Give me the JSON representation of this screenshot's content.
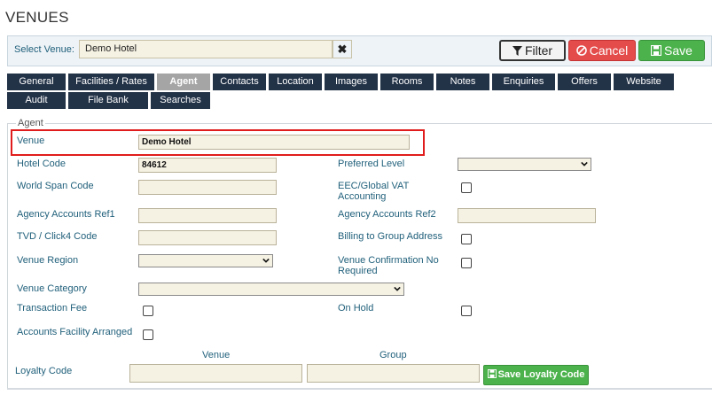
{
  "page": {
    "title": "VENUES"
  },
  "select_venue": {
    "label": "Select Venue:",
    "value": "Demo Hotel",
    "clear_glyph": "✖"
  },
  "actions": {
    "filter": "Filter",
    "cancel": "Cancel",
    "save": "Save"
  },
  "tabs": [
    {
      "label": "General",
      "active": false
    },
    {
      "label": "Facilities / Rates",
      "active": false
    },
    {
      "label": "Agent",
      "active": true
    },
    {
      "label": "Contacts",
      "active": false
    },
    {
      "label": "Location",
      "active": false
    },
    {
      "label": "Images",
      "active": false
    },
    {
      "label": "Rooms",
      "active": false
    },
    {
      "label": "Notes",
      "active": false
    },
    {
      "label": "Enquiries",
      "active": false
    },
    {
      "label": "Offers",
      "active": false
    },
    {
      "label": "Website",
      "active": false
    },
    {
      "label": "Audit",
      "active": false
    },
    {
      "label": "File Bank",
      "active": false
    },
    {
      "label": "Searches",
      "active": false
    }
  ],
  "agent": {
    "legend": "Agent",
    "venue": {
      "label": "Venue",
      "value": "Demo Hotel"
    },
    "hotel_code": {
      "label": "Hotel Code",
      "value": "84612"
    },
    "world_span_code": {
      "label": "World Span Code",
      "value": ""
    },
    "agency_ref1": {
      "label": "Agency Accounts Ref1",
      "value": ""
    },
    "tvd_click4": {
      "label": "TVD / Click4 Code",
      "value": ""
    },
    "venue_region": {
      "label": "Venue Region",
      "value": ""
    },
    "venue_category": {
      "label": "Venue Category",
      "value": ""
    },
    "transaction_fee": {
      "label": "Transaction Fee",
      "checked": false
    },
    "accounts_facility": {
      "label": "Accounts Facility Arranged",
      "checked": false
    },
    "preferred_level": {
      "label": "Preferred Level",
      "value": ""
    },
    "eec_vat": {
      "label": "EEC/Global VAT Accounting",
      "checked": false
    },
    "agency_ref2": {
      "label": "Agency Accounts Ref2",
      "value": ""
    },
    "billing_group": {
      "label": "Billing to Group Address",
      "checked": false
    },
    "venue_conf_required": {
      "label": "Venue Confirmation No Required",
      "checked": false
    },
    "on_hold": {
      "label": "On Hold",
      "checked": false
    },
    "loyalty": {
      "label": "Loyalty Code",
      "venue_header": "Venue",
      "group_header": "Group",
      "venue_value": "",
      "group_value": "",
      "save_label": "Save Loyalty Code"
    }
  },
  "colors": {
    "tab_bg": "#223247",
    "tab_active_bg": "#a5a5a5",
    "cancel": "#e44b4b",
    "save": "#4cb24c",
    "highlight": "#e11c1c"
  }
}
